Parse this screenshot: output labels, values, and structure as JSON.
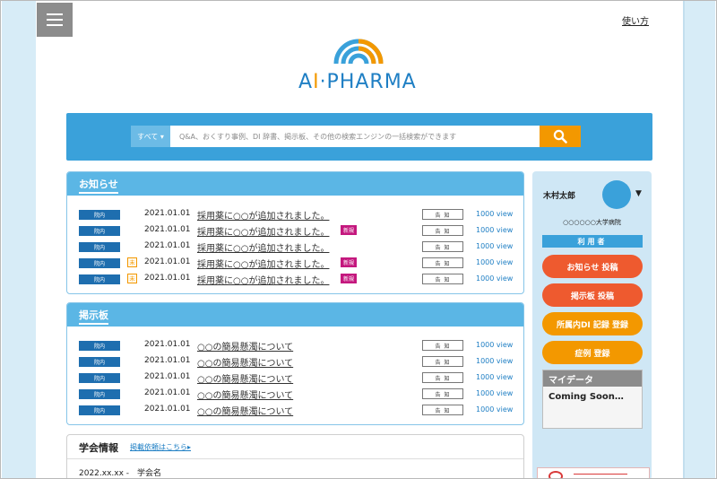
{
  "header": {
    "help_label": "使い方"
  },
  "logo": {
    "text_a": "A",
    "text_dot": "I",
    "text_rest": "·PHARMA",
    "colors": {
      "blue": "#1f7fc4",
      "orange": "#f39800",
      "sky": "#3aa1da"
    }
  },
  "search": {
    "category_label": "すべて",
    "placeholder": "Q&A、おくすり事例、DI 辞書、掲示板、その他の検索エンジンの一括検索ができます",
    "button_icon": "search-icon"
  },
  "notices": {
    "title": "お知らせ",
    "items": [
      {
        "tag": "院内",
        "mark": "",
        "date": "2021.01.01",
        "title": "採用薬に○○が追加されました。",
        "badge": "",
        "kind": "告知",
        "views": "1000 view"
      },
      {
        "tag": "院内",
        "mark": "",
        "date": "2021.01.01",
        "title": "採用薬に○○が追加されました。",
        "badge": "新規",
        "kind": "告知",
        "views": "1000 view"
      },
      {
        "tag": "院内",
        "mark": "",
        "date": "2021.01.01",
        "title": "採用薬に○○が追加されました。",
        "badge": "",
        "kind": "告知",
        "views": "1000 view"
      },
      {
        "tag": "院内",
        "mark": "未",
        "date": "2021.01.01",
        "title": "採用薬に○○が追加されました。",
        "badge": "新規",
        "kind": "告知",
        "views": "1000 view"
      },
      {
        "tag": "院内",
        "mark": "未",
        "date": "2021.01.01",
        "title": "採用薬に○○が追加されました。",
        "badge": "新規",
        "kind": "告知",
        "views": "1000 view"
      }
    ]
  },
  "board": {
    "title": "掲示板",
    "items": [
      {
        "tag": "院内",
        "date": "2021.01.01",
        "title": "○○の簡易懸濁について",
        "kind": "告知",
        "views": "1000 view"
      },
      {
        "tag": "院内",
        "date": "2021.01.01",
        "title": "○○の簡易懸濁について",
        "kind": "告知",
        "views": "1000 view"
      },
      {
        "tag": "院内",
        "date": "2021.01.01",
        "title": "○○の簡易懸濁について",
        "kind": "告知",
        "views": "1000 view"
      },
      {
        "tag": "院内",
        "date": "2021.01.01",
        "title": "○○の簡易懸濁について",
        "kind": "告知",
        "views": "1000 view"
      },
      {
        "tag": "院内",
        "date": "2021.01.01",
        "title": "○○の簡易懸濁について",
        "kind": "告知",
        "views": "1000 view"
      }
    ]
  },
  "gakkai": {
    "title": "学会情報",
    "link_label": "掲載依頼はこちら▸",
    "item": "2022.xx.xx -　学会名"
  },
  "sidebar": {
    "user_name": "木村太郎",
    "caret": "▼",
    "hospital": "○○○○○○大学病院",
    "role": "利用者",
    "buttons": [
      {
        "label": "お知らせ 投稿",
        "color": "red"
      },
      {
        "label": "掲示板 投稿",
        "color": "red"
      },
      {
        "label": "所属内DI 記録 登録",
        "color": "orange"
      },
      {
        "label": "症例 登録",
        "color": "orange"
      }
    ],
    "mydata_title": "マイデータ",
    "mydata_body": "Coming Soon…"
  }
}
